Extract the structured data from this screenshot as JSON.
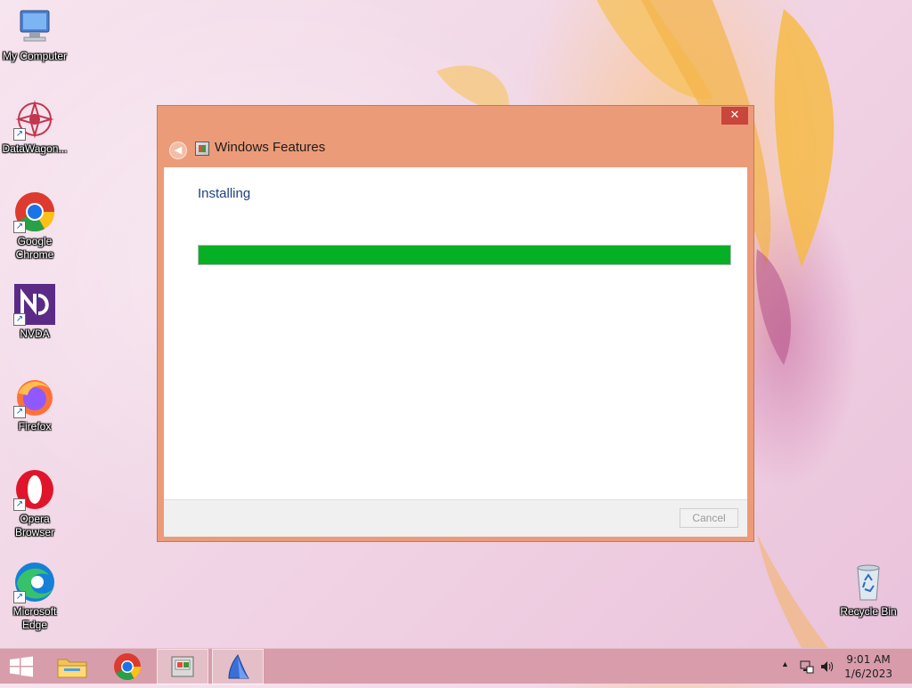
{
  "desktop": {
    "icons": [
      {
        "label": "My Computer"
      },
      {
        "label": "DataWagon..."
      },
      {
        "label": "Google Chrome"
      },
      {
        "label": "NVDA"
      },
      {
        "label": "Firefox"
      },
      {
        "label": "Opera Browser"
      },
      {
        "label": "Microsoft Edge"
      },
      {
        "label": "Recycle Bin"
      }
    ]
  },
  "dialog": {
    "title": "Windows Features",
    "close_label": "✕",
    "status": "Installing",
    "progress_fraction": 1.0,
    "cancel_label": "Cancel"
  },
  "taskbar": {
    "time": "9:01 AM",
    "date": "1/6/2023",
    "items": [
      "start-button",
      "file-explorer",
      "google-chrome",
      "windows-features",
      "app-sail"
    ]
  },
  "colors": {
    "dialog_frame": "#ec9b78",
    "progress_green": "#06b025",
    "close_red": "#c8463c",
    "taskbar": "#d698a6"
  }
}
